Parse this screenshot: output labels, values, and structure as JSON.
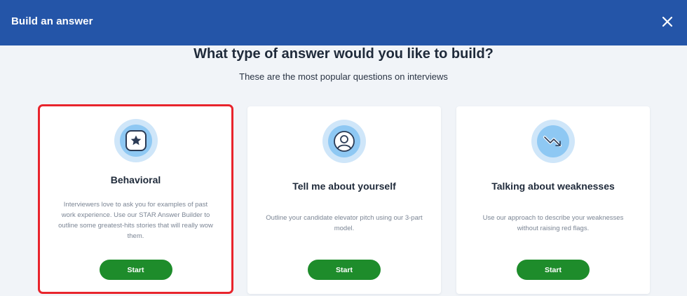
{
  "header": {
    "title": "Build an answer",
    "close_icon": "close-icon"
  },
  "main": {
    "title": "What type of answer would you like to build?",
    "subtitle": "These are the most popular questions on interviews"
  },
  "cards": [
    {
      "title": "Behavioral",
      "description": "Interviewers love to ask you for examples of past work experience. Use our STAR Answer Builder to outline some greatest-hits stories that will really wow them.",
      "button_label": "Start",
      "icon": "star-icon",
      "selected": true
    },
    {
      "title": "Tell me about yourself",
      "description": "Outline your candidate elevator pitch using our 3-part model.",
      "button_label": "Start",
      "icon": "user-icon",
      "selected": false
    },
    {
      "title": "Talking about weaknesses",
      "description": "Use our approach to describe your weaknesses without raising red flags.",
      "button_label": "Start",
      "icon": "trend-down-icon",
      "selected": false
    }
  ],
  "colors": {
    "header_bg": "#2455a8",
    "button_green": "#1e8c2b",
    "selection_red": "#e8242c",
    "icon_light": "#cfe6f9",
    "icon_mid": "#8ec8f3"
  }
}
